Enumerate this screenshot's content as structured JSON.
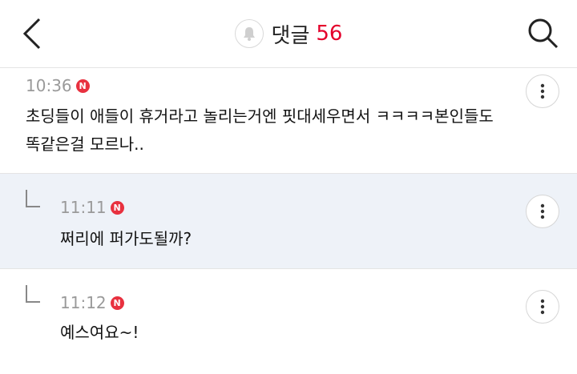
{
  "header": {
    "title": "댓글",
    "count": "56",
    "icons": [
      "back-arrow-icon",
      "bell-icon",
      "search-icon"
    ]
  },
  "comments": [
    {
      "time": "10:36",
      "badge": "N",
      "text_line1": "초딩들이 애들이 휴거라고 놀리는거엔 핏대세우면서 ㅋㅋㅋㅋ본인들도",
      "text_line2": "똑같은걸 모르나..",
      "is_reply": false
    },
    {
      "time": "11:11",
      "badge": "N",
      "text": "쩌리에 퍼가도될까?",
      "is_reply": true
    },
    {
      "time": "11:12",
      "badge": "N",
      "text": "예스여요~!",
      "is_reply": true
    }
  ],
  "colors": {
    "accent": "#e4002b",
    "badge": "#e8313f",
    "reply_bg": "#eef2f8"
  }
}
